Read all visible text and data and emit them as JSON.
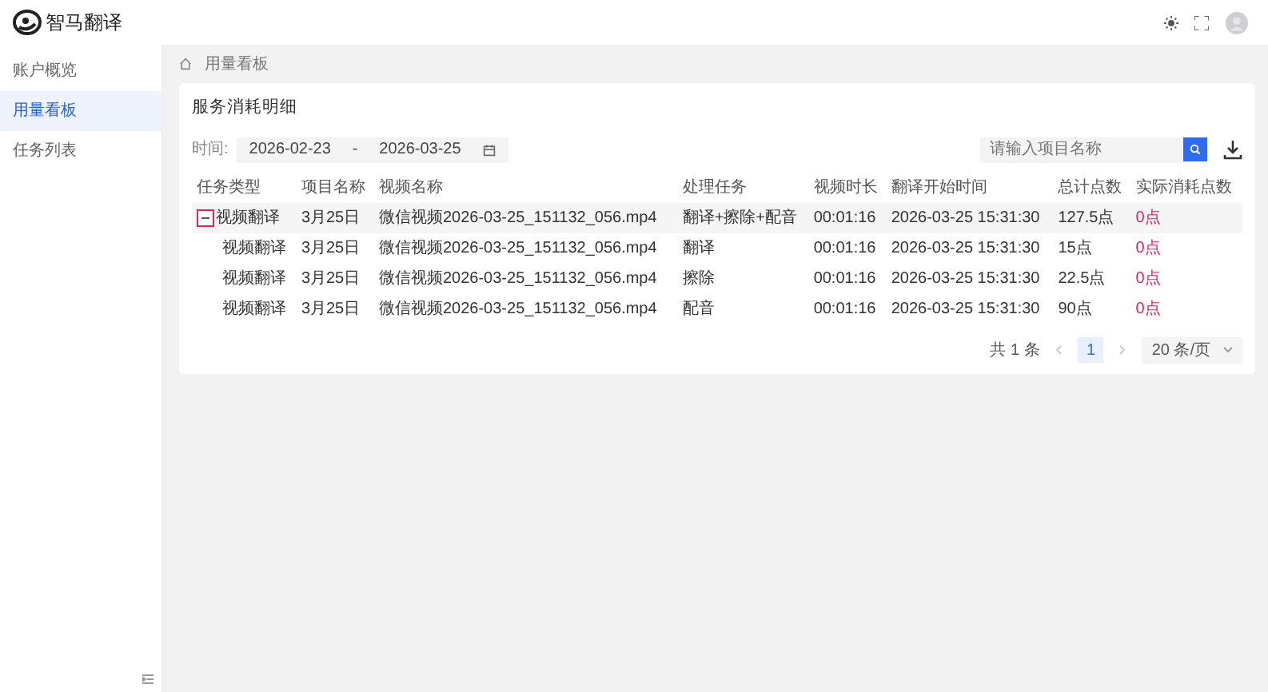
{
  "app": {
    "title": "智马翻译"
  },
  "sidebar": {
    "items": [
      {
        "label": "账户概览",
        "selected": false
      },
      {
        "label": "用量看板",
        "selected": true
      },
      {
        "label": "任务列表",
        "selected": false
      }
    ]
  },
  "breadcrumb": [
    "用量看板"
  ],
  "card": {
    "title": "服务消耗明细",
    "filter": {
      "label": "时间:",
      "start": "2026-02-23",
      "separator": "-",
      "end": "2026-03-25",
      "search_placeholder": "请输入项目名称"
    },
    "table": {
      "columns": [
        "任务类型",
        "项目名称",
        "视频名称",
        "处理任务",
        "视频时长",
        "翻译开始时间",
        "总计点数",
        "实际消耗点数"
      ],
      "rows": [
        {
          "cells": [
            "视频翻译",
            "3月25日",
            "微信视频2026-03-25_151132_056.mp4",
            "翻译+擦除+配音",
            "00:01:16",
            "2026-03-25 15:31:30",
            "127.5点",
            "0点"
          ],
          "expanded": true,
          "children": [
            {
              "cells": [
                "视频翻译",
                "3月25日",
                "微信视频2026-03-25_151132_056.mp4",
                "翻译",
                "00:01:16",
                "2026-03-25 15:31:30",
                "15点",
                "0点"
              ]
            },
            {
              "cells": [
                "视频翻译",
                "3月25日",
                "微信视频2026-03-25_151132_056.mp4",
                "擦除",
                "00:01:16",
                "2026-03-25 15:31:30",
                "22.5点",
                "0点"
              ]
            },
            {
              "cells": [
                "视频翻译",
                "3月25日",
                "微信视频2026-03-25_151132_056.mp4",
                "配音",
                "00:01:16",
                "2026-03-25 15:31:30",
                "90点",
                "0点"
              ]
            }
          ]
        }
      ]
    },
    "pagination": {
      "total": "共 1 条",
      "pages": [
        {
          "label": "1",
          "selected": true
        }
      ],
      "page_size": "20 条/页"
    }
  }
}
